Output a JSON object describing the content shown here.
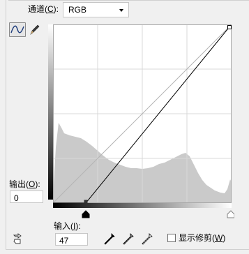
{
  "channel": {
    "label": "通道(",
    "mnemonic": "C",
    "label_end": "):",
    "value": "RGB"
  },
  "output": {
    "label": "输出(",
    "mnemonic": "O",
    "label_end": "):",
    "value": "0"
  },
  "input": {
    "label": "输入(",
    "mnemonic": "I",
    "label_end": "):",
    "value": "47"
  },
  "show_clipping": {
    "label": "显示修剪(",
    "mnemonic": "W",
    "label_end": ")",
    "checked": false
  },
  "icons": {
    "curve_tool": "curve-icon",
    "pencil_tool": "pencil-icon",
    "hand_adjust": "hand-adjust-icon",
    "black_eyedropper": "eyedropper-black-icon",
    "gray_eyedropper": "eyedropper-gray-icon",
    "white_eyedropper": "eyedropper-white-icon"
  },
  "curve": {
    "black_point_input": 47,
    "black_point_output": 0,
    "white_point_input": 255,
    "white_point_output": 255
  },
  "colors": {
    "histogram": "#cacaca",
    "grid": "#d8d8d8",
    "curve": "#000000",
    "baseline": "#b4b4b4"
  }
}
